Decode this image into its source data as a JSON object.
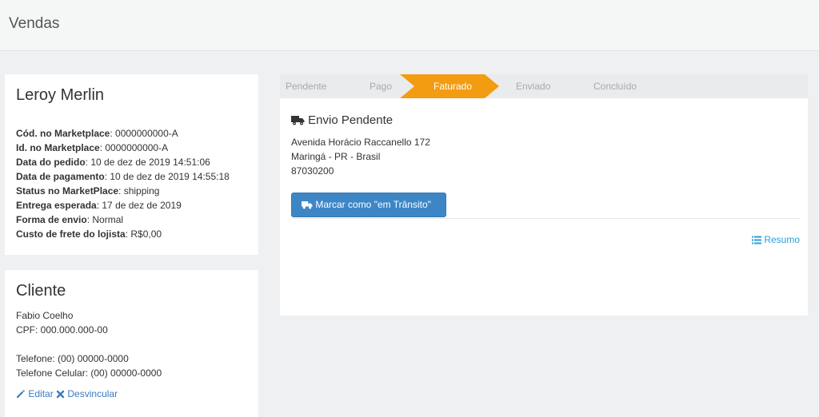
{
  "header": {
    "title": "Vendas"
  },
  "store": {
    "title": "Leroy Merlin",
    "rows": [
      {
        "label": "Cód. no Marketplace",
        "value": ": 0000000000-A"
      },
      {
        "label": "Id. no Marketplace",
        "value": ": 0000000000-A"
      },
      {
        "label": "Data do pedido",
        "value": ": 10 de dez de 2019 14:51:06"
      },
      {
        "label": "Data de pagamento",
        "value": ": 10 de dez de 2019 14:55:18"
      },
      {
        "label": "Status no MarketPlace",
        "value": ": shipping"
      },
      {
        "label": "Entrega esperada",
        "value": ": 17 de dez de 2019"
      },
      {
        "label": "Forma de envio",
        "value": ": Normal"
      },
      {
        "label": "Custo de frete do lojista",
        "value": ": R$0,00"
      }
    ]
  },
  "client": {
    "title": "Cliente",
    "name": "Fabio Coelho",
    "cpf": "CPF: 000.000.000-00",
    "phone": "Telefone: (00) 00000-0000",
    "mobile": "Telefone Celular: (00) 00000-0000",
    "edit_label": "Editar",
    "unlink_label": "Desvincular"
  },
  "order": {
    "steps": [
      "Pendente",
      "Pago",
      "Faturado",
      "Enviado",
      "Concluído"
    ],
    "active_step": "Faturado",
    "shipping_title": "Envio Pendente",
    "address_line1": "Avenida Horácio Raccanello 172",
    "address_line2": "Maringá - PR - Brasil",
    "postal_code": "87030200",
    "mark_button": "Marcar como \"em Trânsito\"",
    "summary_link": "Resumo"
  },
  "colors": {
    "accent_orange": "#f39c12",
    "primary_button": "#3d86c6",
    "link_blue": "#2a9fd6"
  },
  "icons": {
    "truck": "truck-icon",
    "edit": "pencil-icon",
    "unlink": "x-icon",
    "summary": "list-icon"
  }
}
